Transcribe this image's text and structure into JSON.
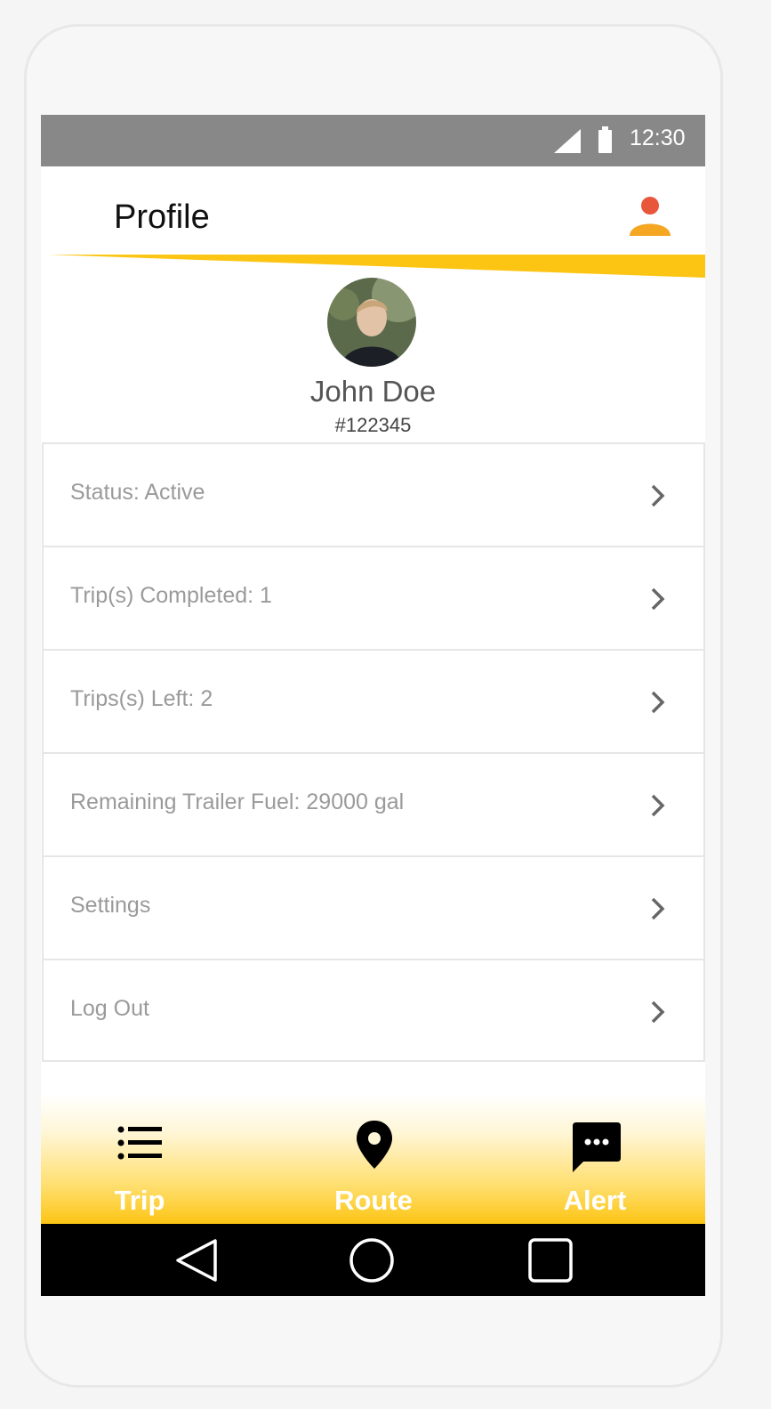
{
  "status_bar": {
    "time": "12:30",
    "signal_icon": "signal-icon",
    "battery_icon": "battery-icon"
  },
  "app_bar": {
    "title": "Profile",
    "profile_icon": "person-icon"
  },
  "user": {
    "name": "John Doe",
    "id": "#122345",
    "avatar": "avatar-photo"
  },
  "menu": {
    "items": [
      {
        "label": "Status: Active"
      },
      {
        "label": "Trip(s) Completed: 1"
      },
      {
        "label": "Trips(s) Left: 2"
      },
      {
        "label": "Remaining Trailer Fuel: 29000 gal"
      },
      {
        "label": "Settings"
      },
      {
        "label": "Log Out"
      }
    ]
  },
  "bottom_nav": {
    "items": [
      {
        "label": "Trip",
        "icon": "list-icon"
      },
      {
        "label": "Route",
        "icon": "location-pin-icon"
      },
      {
        "label": "Alert",
        "icon": "chat-bubble-icon"
      }
    ]
  },
  "system_nav": {
    "back": "back-triangle-icon",
    "home": "home-circle-icon",
    "recents": "recents-square-icon"
  },
  "colors": {
    "accent": "#fcc514",
    "status_bar": "#888888",
    "profile_icon_head": "#e8563b",
    "profile_icon_body": "#f5a623"
  }
}
